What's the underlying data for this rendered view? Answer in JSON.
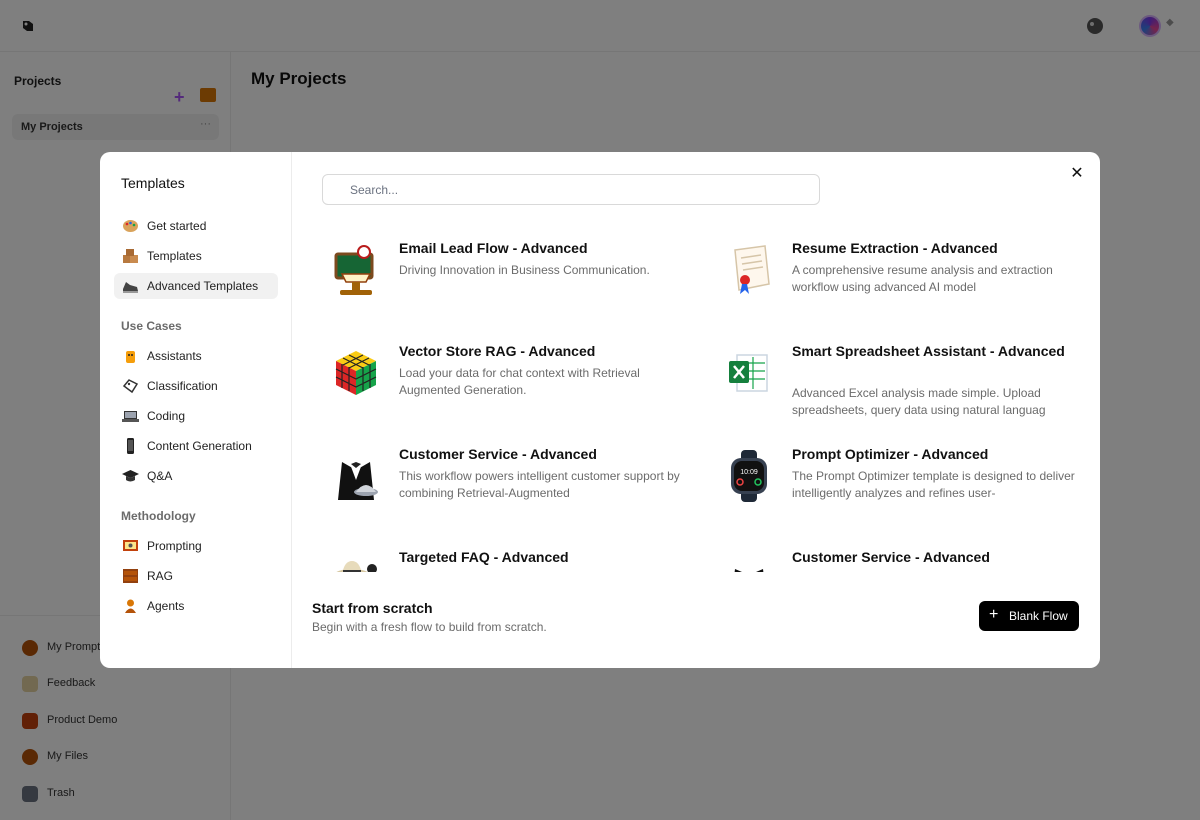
{
  "app": {
    "sidebar": {
      "title": "Projects",
      "active_item": "My Projects",
      "active_item_menu": "···",
      "bottom_items": [
        {
          "label": "My Prompts",
          "icon": "bag-icon"
        },
        {
          "label": "Feedback",
          "icon": "note-icon"
        },
        {
          "label": "Product Demo",
          "icon": "demo-icon"
        },
        {
          "label": "My Files",
          "icon": "bag-icon"
        },
        {
          "label": "Trash",
          "icon": "trash-icon"
        }
      ]
    },
    "main_title": "My Projects"
  },
  "modal": {
    "nav": {
      "heading": "Templates",
      "top_items": [
        {
          "label": "Get started",
          "icon": "palette-icon",
          "active": false
        },
        {
          "label": "Templates",
          "icon": "boxes-icon",
          "active": false
        },
        {
          "label": "Advanced Templates",
          "icon": "shoe-icon",
          "active": true
        }
      ],
      "use_cases_title": "Use Cases",
      "use_cases": [
        {
          "label": "Assistants",
          "icon": "robot-icon"
        },
        {
          "label": "Classification",
          "icon": "tag-icon"
        },
        {
          "label": "Coding",
          "icon": "laptop-icon"
        },
        {
          "label": "Content Generation",
          "icon": "phone-icon"
        },
        {
          "label": "Q&A",
          "icon": "graduation-cap-icon"
        }
      ],
      "methodology_title": "Methodology",
      "methodology": [
        {
          "label": "Prompting",
          "icon": "projector-icon"
        },
        {
          "label": "RAG",
          "icon": "books-icon"
        },
        {
          "label": "Agents",
          "icon": "agent-icon"
        }
      ]
    },
    "close_label": "✕",
    "search": {
      "placeholder": "Search..."
    },
    "templates": [
      {
        "title": "Email Lead Flow - Advanced",
        "description": "Driving Innovation in Business Communication.",
        "icon": "lectern-icon"
      },
      {
        "title": "Resume Extraction - Advanced",
        "description": "A comprehensive resume analysis and extraction workflow using advanced AI model",
        "icon": "certificate-icon"
      },
      {
        "title": "Vector Store RAG - Advanced",
        "description": "Load your data for chat context with Retrieval Augmented Generation.",
        "icon": "rubiks-cube-icon"
      },
      {
        "title": "Smart Spreadsheet Assistant - Advanced",
        "description": "Advanced Excel analysis made simple. Upload spreadsheets, query data using natural languag",
        "icon": "excel-icon"
      },
      {
        "title": "Customer Service - Advanced",
        "description": "This workflow powers intelligent customer support by combining Retrieval-Augmented",
        "icon": "butler-icon"
      },
      {
        "title": "Prompt Optimizer - Advanced",
        "description": "The Prompt Optimizer template is designed to deliver intelligently analyzes and refines user-",
        "icon": "smartwatch-icon"
      },
      {
        "title": "Targeted FAQ - Advanced",
        "description": "",
        "icon": "hat-icon"
      },
      {
        "title": "Customer Service - Advanced",
        "description": "",
        "icon": "butler-icon"
      }
    ],
    "footer": {
      "title": "Start from scratch",
      "subtitle": "Begin with a fresh flow to build from scratch.",
      "button_label": "Blank Flow",
      "button_icon": "+"
    }
  }
}
